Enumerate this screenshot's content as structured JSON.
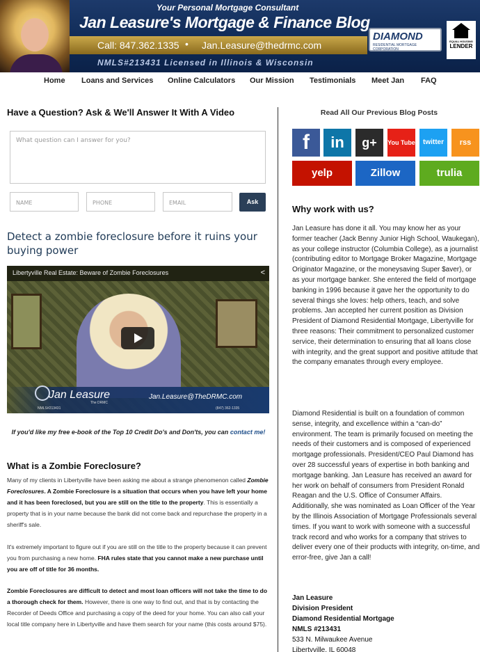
{
  "header": {
    "tagline": "Your Personal Mortgage Consultant",
    "title": "Jan Leasure's Mortgage & Finance Blog",
    "phone": "Call: 847.362.1335",
    "email": "Jan.Leasure@thedrmc.com",
    "nmls": "NMLS#213431 Licensed in Illinois & Wisconsin",
    "logo_text": "DIAMOND",
    "logo_sub": "RESIDENTIAL MORTGAGE CORPORATION",
    "eh_line1": "EQUAL HOUSING",
    "eh_line2": "LENDER"
  },
  "nav": {
    "items": [
      "Home",
      "Loans and Services",
      "Online Calculators",
      "Our Mission",
      "Testimonials",
      "Meet Jan",
      "FAQ"
    ]
  },
  "ask": {
    "heading": "Have a Question? Ask & We'll Answer It With A Video",
    "textarea_placeholder": "What question can I answer for you?",
    "name_placeholder": "NAME",
    "phone_placeholder": "PHONE",
    "email_placeholder": "EMAIL",
    "button": "Ask"
  },
  "post": {
    "title": "Detect a zombie foreclosure before it ruins your buying power",
    "video": {
      "title": "Libertyville Real Estate: Beware of Zombie Foreclosures",
      "lower_name": "Jan Leasure",
      "lower_sub": "The DRMC",
      "lower_email": "Jan.Leasure@TheDRMC.com",
      "lower_nmls": "NMLS#213431",
      "lower_phone": "(847) 362-1335"
    },
    "ebook_text": "If you'd like my free e-book of the Top 10 Credit Do's and Don'ts, you can ",
    "ebook_link": "contact me!",
    "section_heading": "What is a Zombie Foreclosure?",
    "p1_a": "Many of my clients in Libertyville have been asking me about a strange phenomenon called ",
    "p1_b": "Zombie Foreclosures",
    "p1_c": ". A Zombie Foreclosure is a situation that occurs when you have left your home and it has been foreclosed, but you are still on the title to the property",
    "p1_d": ". This is essentially a property that is in your name because the bank did not come back and repurchase the property in a sheriff's sale.",
    "p2_a": "It's extremely important to figure out if you are still on the title to the property because it can prevent you from purchasing a new home. ",
    "p2_b": "FHA rules state that you cannot make a new purchase until you are off of title for 36 months.",
    "p3_a": "Zombie Foreclosures are difficult to detect and most loan officers will not take the time to do a thorough check for them.",
    "p3_b": " However, there is one way to find out, and that is by contacting the Recorder of Deeds Office and purchasing a copy of the deed for your home. You can also call your local title company here in Libertyville and have them search for your name (this costs around $75)."
  },
  "sidebar": {
    "read_all": "Read All Our Previous Blog Posts",
    "social": {
      "facebook": "f",
      "linkedin": "in",
      "googleplus": "g+",
      "youtube": "You Tube",
      "twitter": "twitter",
      "rss": "rss",
      "yelp": "yelp",
      "zillow": "Zillow",
      "trulia": "trulia"
    },
    "why_heading": "Why work with us?",
    "why_p1": "Jan Leasure has done it all. You may know her as your former teacher (Jack Benny Junior High School, Waukegan), as your college instructor (Columbia College), as a journalist (contributing editor to Mortgage Broker Magazine, Mortgage Originator Magazine, or the moneysaving Super $aver), or as your mortgage banker. She entered the field of mortgage banking in 1996 because it gave her the opportunity to do several things she loves: help others, teach, and solve problems. Jan accepted her current position as Division President of Diamond Residential Mortgage, Libertyville for three reasons: Their commitment to personalized customer service, their determination to ensuring that all loans close with integrity, and the great support and positive attitude that the company emanates through every employee.",
    "why_p2": "Diamond Residential is built on a foundation of common sense, integrity, and excellence within a “can-do” environment. The team is primarily focused on meeting the needs of their customers and is composed of experienced mortgage professionals. President/CEO Paul Diamond has over 28 successful years of expertise in both banking and mortgage banking. Jan Leasure has received an award for her work on behalf of consumers from President Ronald Reagan and the U.S. Office of Consumer Affairs. Additionally, she was nominated as Loan Officer of the Year by the Illinois Association of Mortgage Professionals several times. If you want to work with someone with a successful track record and who works for a company that strives to deliver every one of their products with integrity, on-time, and error-free, give Jan a call!",
    "sig_name": "Jan Leasure",
    "sig_title": "Division President",
    "sig_company": "Diamond Residential Mortgage",
    "sig_nmls": "NMLS #213431",
    "sig_addr1": "533 N. Milwaukee Avenue",
    "sig_addr2": "Libertyville, IL 60048"
  },
  "colors": {
    "banner": "#0f2a55",
    "ask_button": "#2a3f58",
    "facebook": "#3b5998",
    "linkedin": "#0e76a8",
    "googleplus": "#2b2b2b",
    "youtube": "#e62117",
    "twitter": "#1da1f2",
    "rss": "#f7931e",
    "yelp": "#c41200",
    "zillow": "#1c66c4",
    "trulia": "#5eab1f"
  }
}
